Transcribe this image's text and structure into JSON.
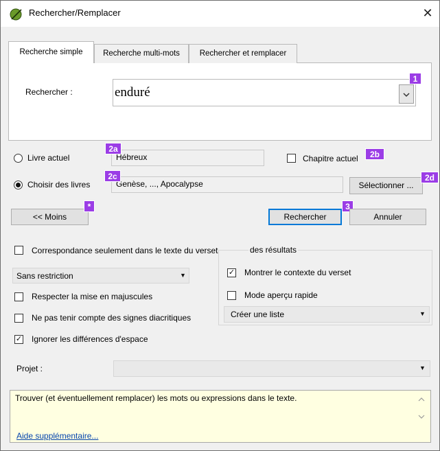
{
  "window": {
    "title": "Rechercher/Remplacer",
    "close_glyph": "✕",
    "app_icon": "green-leaf-icon"
  },
  "tabs": [
    {
      "label": "Recherche simple",
      "active": true
    },
    {
      "label": "Recherche multi-mots",
      "active": false
    },
    {
      "label": "Rechercher et remplacer",
      "active": false
    }
  ],
  "search": {
    "label": "Rechercher :",
    "value": "enduré"
  },
  "scope": {
    "current_book_label": "Livre actuel",
    "current_book_value": "Hébreux",
    "current_book_selected": false,
    "current_chapter_label": "Chapitre actuel",
    "current_chapter_checked": false,
    "choose_books_label": "Choisir des livres",
    "choose_books_value": "Genèse, ..., Apocalypse",
    "choose_books_selected": true,
    "select_button": "Sélectionner ..."
  },
  "buttons": {
    "less": "<< Moins",
    "search": "Rechercher",
    "cancel": "Annuler"
  },
  "badges": {
    "b1": "1",
    "b2a": "2a",
    "b2b": "2b",
    "b2c": "2c",
    "b2d": "2d",
    "star": "*",
    "b3": "3"
  },
  "options": {
    "verse_text_only": {
      "label": "Correspondance seulement dans le texte du verset",
      "checked": false
    },
    "restriction_value": "Sans restriction",
    "match_case": {
      "label": "Respecter la mise en majuscules",
      "checked": false
    },
    "ignore_diacritics": {
      "label": "Ne pas tenir compte des signes diacritiques",
      "checked": false
    },
    "ignore_space": {
      "label": "Ignorer les différences d'espace",
      "checked": true
    }
  },
  "results": {
    "group_label": "des résultats",
    "show_context": {
      "label": "Montrer le contexte du verset",
      "checked": true
    },
    "quick_preview": {
      "label": "Mode aperçu rapide",
      "checked": false
    },
    "output_value": "Créer une liste"
  },
  "project": {
    "label": "Projet :",
    "value": ""
  },
  "info": {
    "text": "Trouver (et éventuellement remplacer) les mots ou expressions dans le texte.",
    "link": "Aide supplémentaire..."
  },
  "colors": {
    "badge": "#9b3de6",
    "info_background": "#ffffe1",
    "focus_border": "#0078d7",
    "link": "#0645ad"
  }
}
